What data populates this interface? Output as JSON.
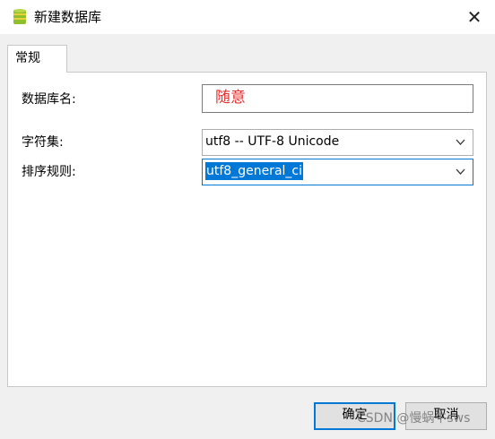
{
  "window": {
    "title": "新建数据库",
    "close_label": "✕"
  },
  "tabs": [
    {
      "label": "常规",
      "active": true
    }
  ],
  "form": {
    "db_name_label": "数据库名:",
    "db_name_value": "随意",
    "db_name_color": "#e53030",
    "charset_label": "字符集:",
    "charset_value": "utf8 -- UTF-8 Unicode",
    "collation_label": "排序规则:",
    "collation_value": "utf8_general_ci"
  },
  "buttons": {
    "ok_label": "确定",
    "cancel_label": "取消"
  },
  "watermark": "CSDN @慢蜗牛sws",
  "colors": {
    "accent": "#0078d7"
  }
}
